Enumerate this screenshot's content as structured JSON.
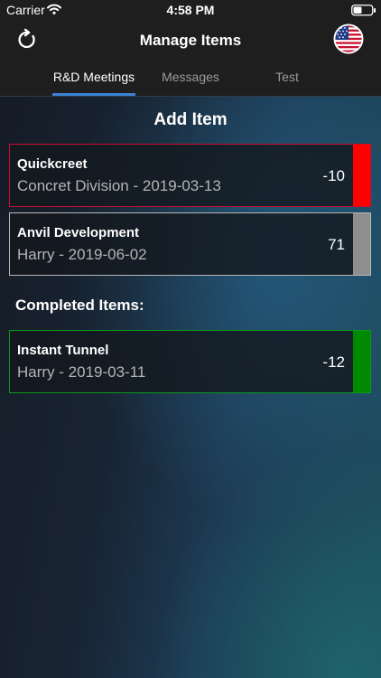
{
  "status_bar": {
    "carrier": "Carrier",
    "time": "4:58 PM",
    "icons": [
      "wifi-icon",
      "battery-icon"
    ]
  },
  "nav": {
    "title": "Manage Items",
    "left_icon": "refresh-icon",
    "right_icon": "us-flag-icon"
  },
  "tabs": [
    {
      "label": "R&D Meetings",
      "active": true
    },
    {
      "label": "Messages",
      "active": false
    },
    {
      "label": "Test",
      "active": false
    }
  ],
  "add_item_label": "Add Item",
  "items": [
    {
      "title": "Quickcreet",
      "subtitle": "Concret Division - 2019-03-13",
      "value": "-10",
      "status_color": "#ff0000",
      "border_color": "#c8102e"
    },
    {
      "title": "Anvil Development",
      "subtitle": "Harry - 2019-06-02",
      "value": "71",
      "status_color": "#8e8e8e",
      "border_color": "#b8b8b8"
    }
  ],
  "completed_label": "Completed Items:",
  "completed_items": [
    {
      "title": "Instant Tunnel",
      "subtitle": "Harry - 2019-03-11",
      "value": "-12",
      "status_color": "#008a00",
      "border_color": "#0a9a1a"
    }
  ],
  "colors": {
    "accent": "#3b82d6",
    "bar_background": "#1e1e1e"
  }
}
